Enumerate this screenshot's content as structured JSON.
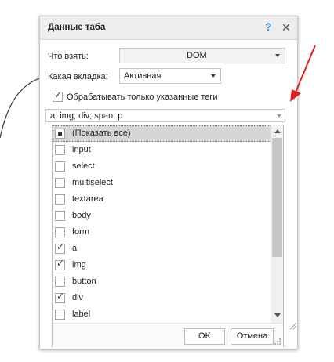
{
  "dialog": {
    "title": "Данные таба",
    "help": "?",
    "close": "✕"
  },
  "form": {
    "what_label": "Что взять:",
    "what_value": "DOM",
    "tab_label": "Какая вкладка:",
    "tab_value": "Активная",
    "only_tags_label": "Обрабатывать только указанные теги",
    "only_tags_checked": true,
    "tags_value": "a; img; div; span; p"
  },
  "tag_list": {
    "items": [
      {
        "label": "(Показать все)",
        "state": "indeterminate"
      },
      {
        "label": "input",
        "state": "unchecked"
      },
      {
        "label": "select",
        "state": "unchecked"
      },
      {
        "label": "multiselect",
        "state": "unchecked"
      },
      {
        "label": "textarea",
        "state": "unchecked"
      },
      {
        "label": "body",
        "state": "unchecked"
      },
      {
        "label": "form",
        "state": "unchecked"
      },
      {
        "label": "a",
        "state": "checked"
      },
      {
        "label": "img",
        "state": "checked"
      },
      {
        "label": "button",
        "state": "unchecked"
      },
      {
        "label": "div",
        "state": "checked"
      },
      {
        "label": "label",
        "state": "unchecked"
      }
    ],
    "ok_label": "OK",
    "cancel_label": "Отмена"
  },
  "colors": {
    "accent_arrow": "#e02020",
    "help_icon": "#2f7fd6"
  }
}
